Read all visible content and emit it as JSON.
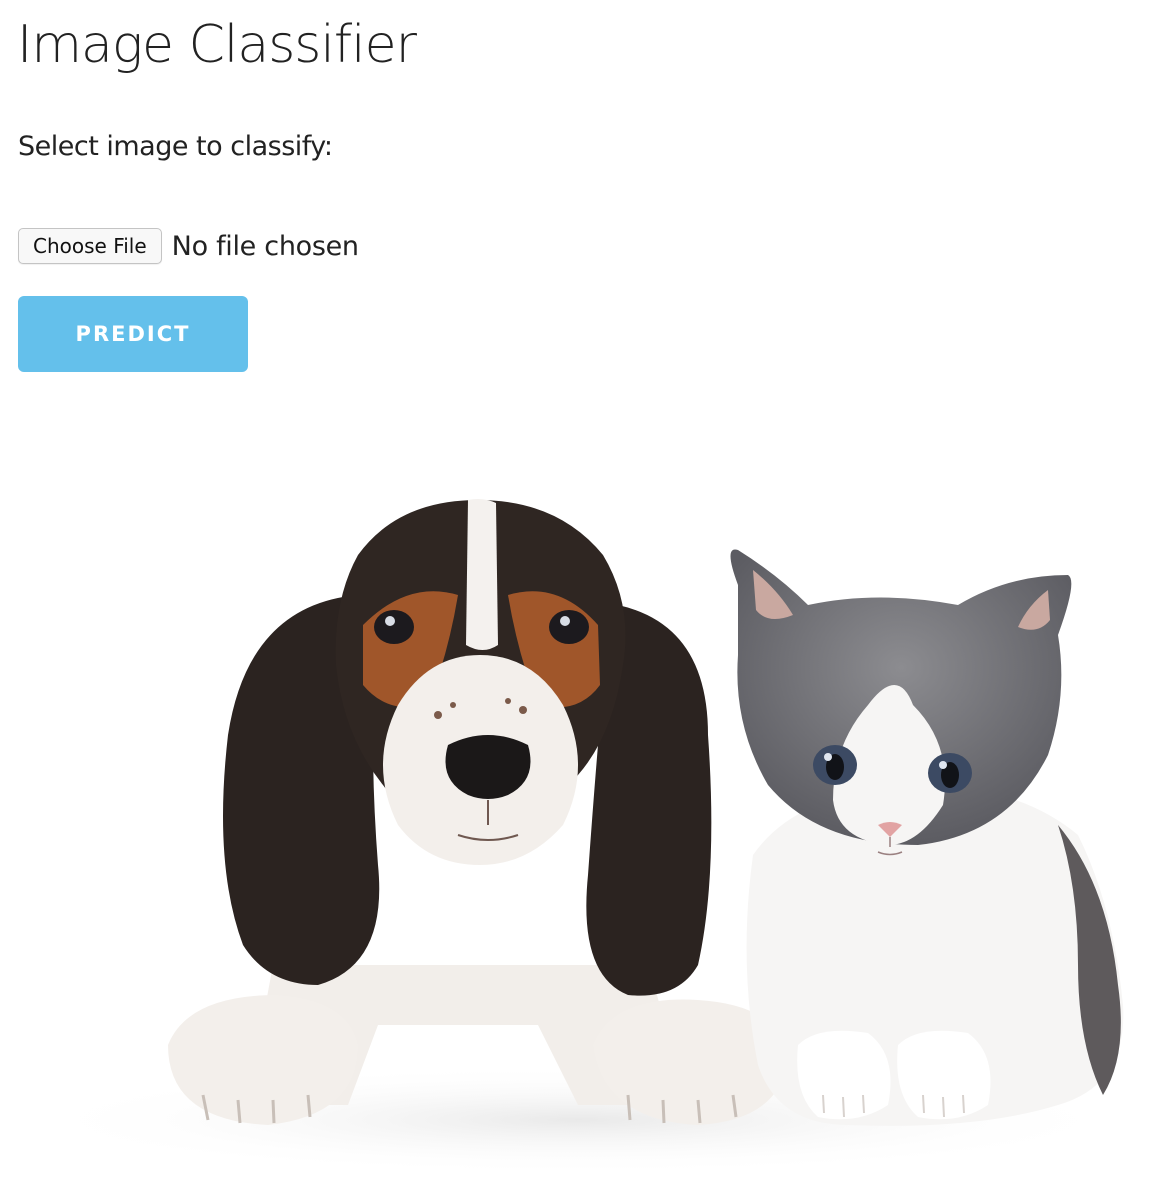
{
  "page": {
    "title": "Image Classifier"
  },
  "form": {
    "prompt": "Select image to classify:",
    "file_button_label": "Choose File",
    "file_status": "No file chosen",
    "predict_label": "PREDICT"
  },
  "colors": {
    "predict_button": "#64c0eb",
    "text": "#222222",
    "background": "#ffffff"
  }
}
